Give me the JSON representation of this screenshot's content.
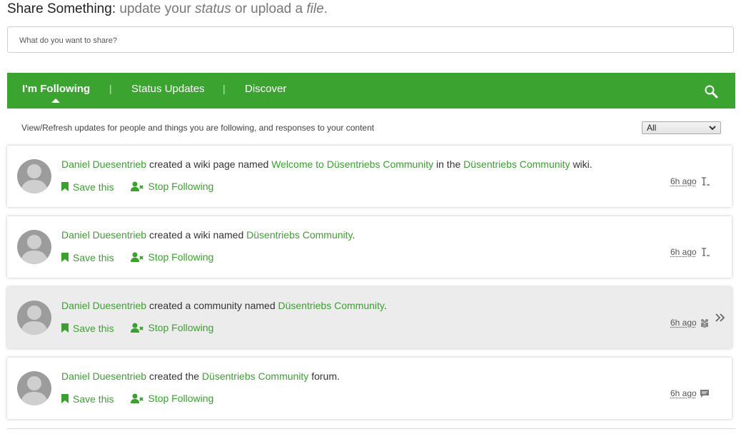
{
  "share": {
    "label": "Share Something:",
    "part1": "update your",
    "status_word": "status",
    "part2": "or upload a",
    "file_word": "file",
    "end": ".",
    "placeholder": "What do you want to share?"
  },
  "nav": {
    "tabs": [
      {
        "label": "I'm Following",
        "active": true
      },
      {
        "label": "Status Updates",
        "active": false
      },
      {
        "label": "Discover",
        "active": false
      }
    ],
    "separator": "|",
    "search_icon": "search-icon",
    "color": "#3ba431"
  },
  "filter": {
    "description": "View/Refresh updates for people and things you are following, and responses to your content",
    "selected": "All"
  },
  "entries": [
    {
      "user": "Daniel Duesentrieb",
      "verb": "created a wiki page named",
      "target": "Welcome to Düsentriebs Community",
      "mid": "in the",
      "target2": "Düsentriebs Community",
      "tail": "wiki.",
      "save": "Save this",
      "stop": "Stop Following",
      "time": "6h ago",
      "icon": "wiki-page-icon"
    },
    {
      "user": "Daniel Duesentrieb",
      "verb": "created a wiki named",
      "target": "Düsentriebs Community",
      "tail": ".",
      "save": "Save this",
      "stop": "Stop Following",
      "time": "6h ago",
      "icon": "wiki-icon"
    },
    {
      "user": "Daniel Duesentrieb",
      "verb": "created a community named",
      "target": "Düsentriebs Community",
      "tail": ".",
      "save": "Save this",
      "stop": "Stop Following",
      "time": "6h ago",
      "icon": "community-icon"
    },
    {
      "user": "Daniel Duesentrieb",
      "verb": "created the",
      "target": "Düsentriebs Community",
      "tail": "forum.",
      "save": "Save this",
      "stop": "Stop Following",
      "time": "6h ago",
      "icon": "forum-icon"
    }
  ],
  "colors": {
    "accent": "#3ba431",
    "link": "#3aa12f",
    "hover_row": "#ececec"
  }
}
